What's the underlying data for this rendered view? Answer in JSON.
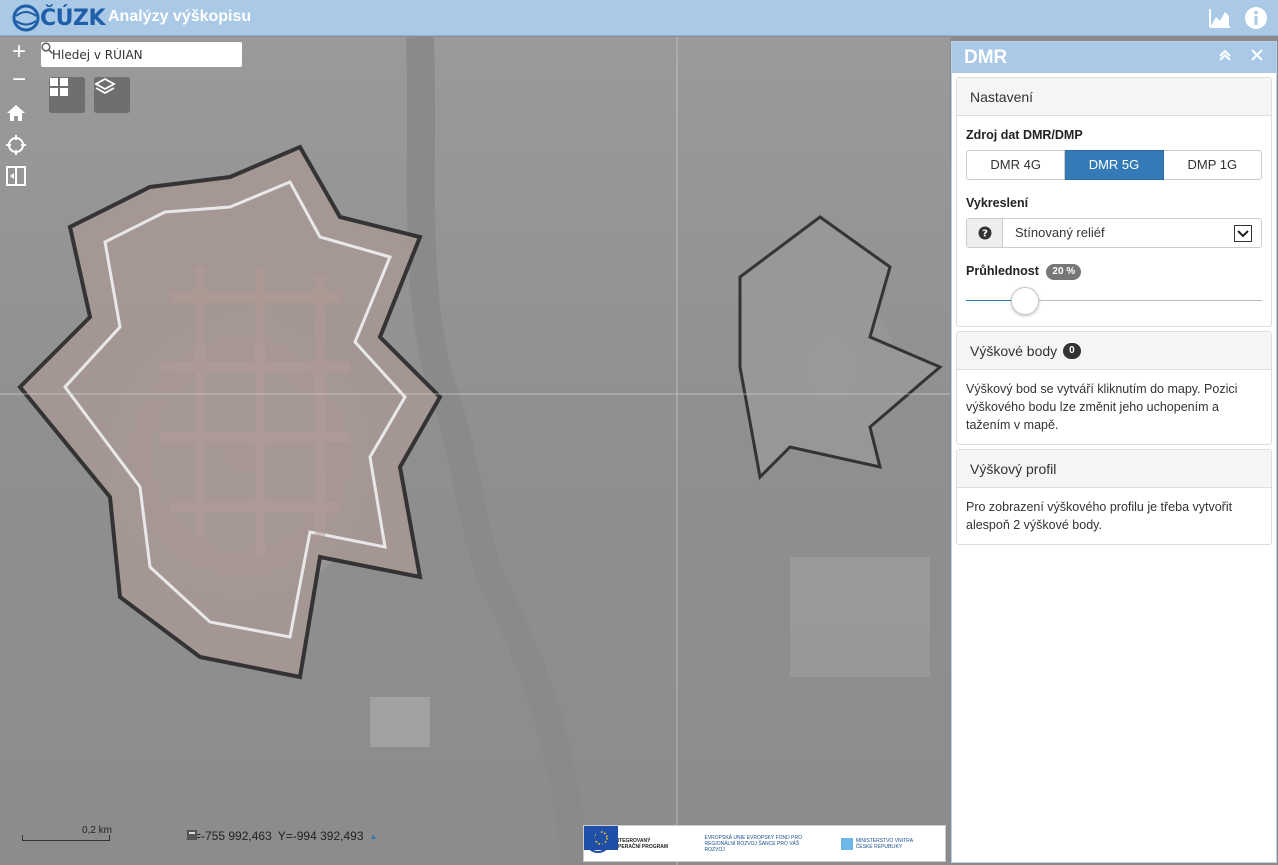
{
  "header": {
    "logo_text": "ČÚZK",
    "title": "Analýzy výškopisu",
    "icons": [
      "chart-icon",
      "info-icon"
    ]
  },
  "map": {
    "search": {
      "placeholder": "Hledej v RÚIAN"
    },
    "controls": [
      "zoom-in-icon",
      "zoom-out-icon",
      "home-icon",
      "locate-icon",
      "compare-icon"
    ],
    "tools": [
      "grid-icon",
      "layers-icon"
    ],
    "scale": "0,2 km",
    "coords": {
      "x": "X=-755 992,463",
      "y": "Y=-994 392,493"
    },
    "eu_logos": {
      "op": "INTEGROVANÝ OPERAČNÍ PROGRAM",
      "eu": "EVROPSKÁ UNIE EVROPSKÝ FOND PRO REGIONÁLNÍ ROZVOJ ŠANCE PRO VÁŠ ROZVOJ",
      "mv": "MINISTERSTVO VNITRA ČESKÉ REPUBLIKY"
    }
  },
  "panel": {
    "title": "DMR",
    "settings": {
      "header": "Nastavení",
      "source_label": "Zdroj dat DMR/DMP",
      "sources": [
        "DMR 4G",
        "DMR 5G",
        "DMP 1G"
      ],
      "active_source": "DMR 5G",
      "render_label": "Vykreslení",
      "render_value": "Stínovaný reliéf",
      "opacity_label": "Průhlednost",
      "opacity_badge": "20 %",
      "opacity_value": 0.2
    },
    "points": {
      "header": "Výškové body",
      "count": "0",
      "text": "Výškový bod se vytváří kliknutím do mapy. Pozici výškového bodu lze změnit jeho uchopením a tažením v mapě."
    },
    "profile": {
      "header": "Výškový profil",
      "text": "Pro zobrazení výškového profilu je třeba vytvořit alespoň 2 výškové body."
    }
  },
  "colors": {
    "header": "#a9c9e6",
    "accent": "#337ab7",
    "logo": "#1f5fa8"
  }
}
